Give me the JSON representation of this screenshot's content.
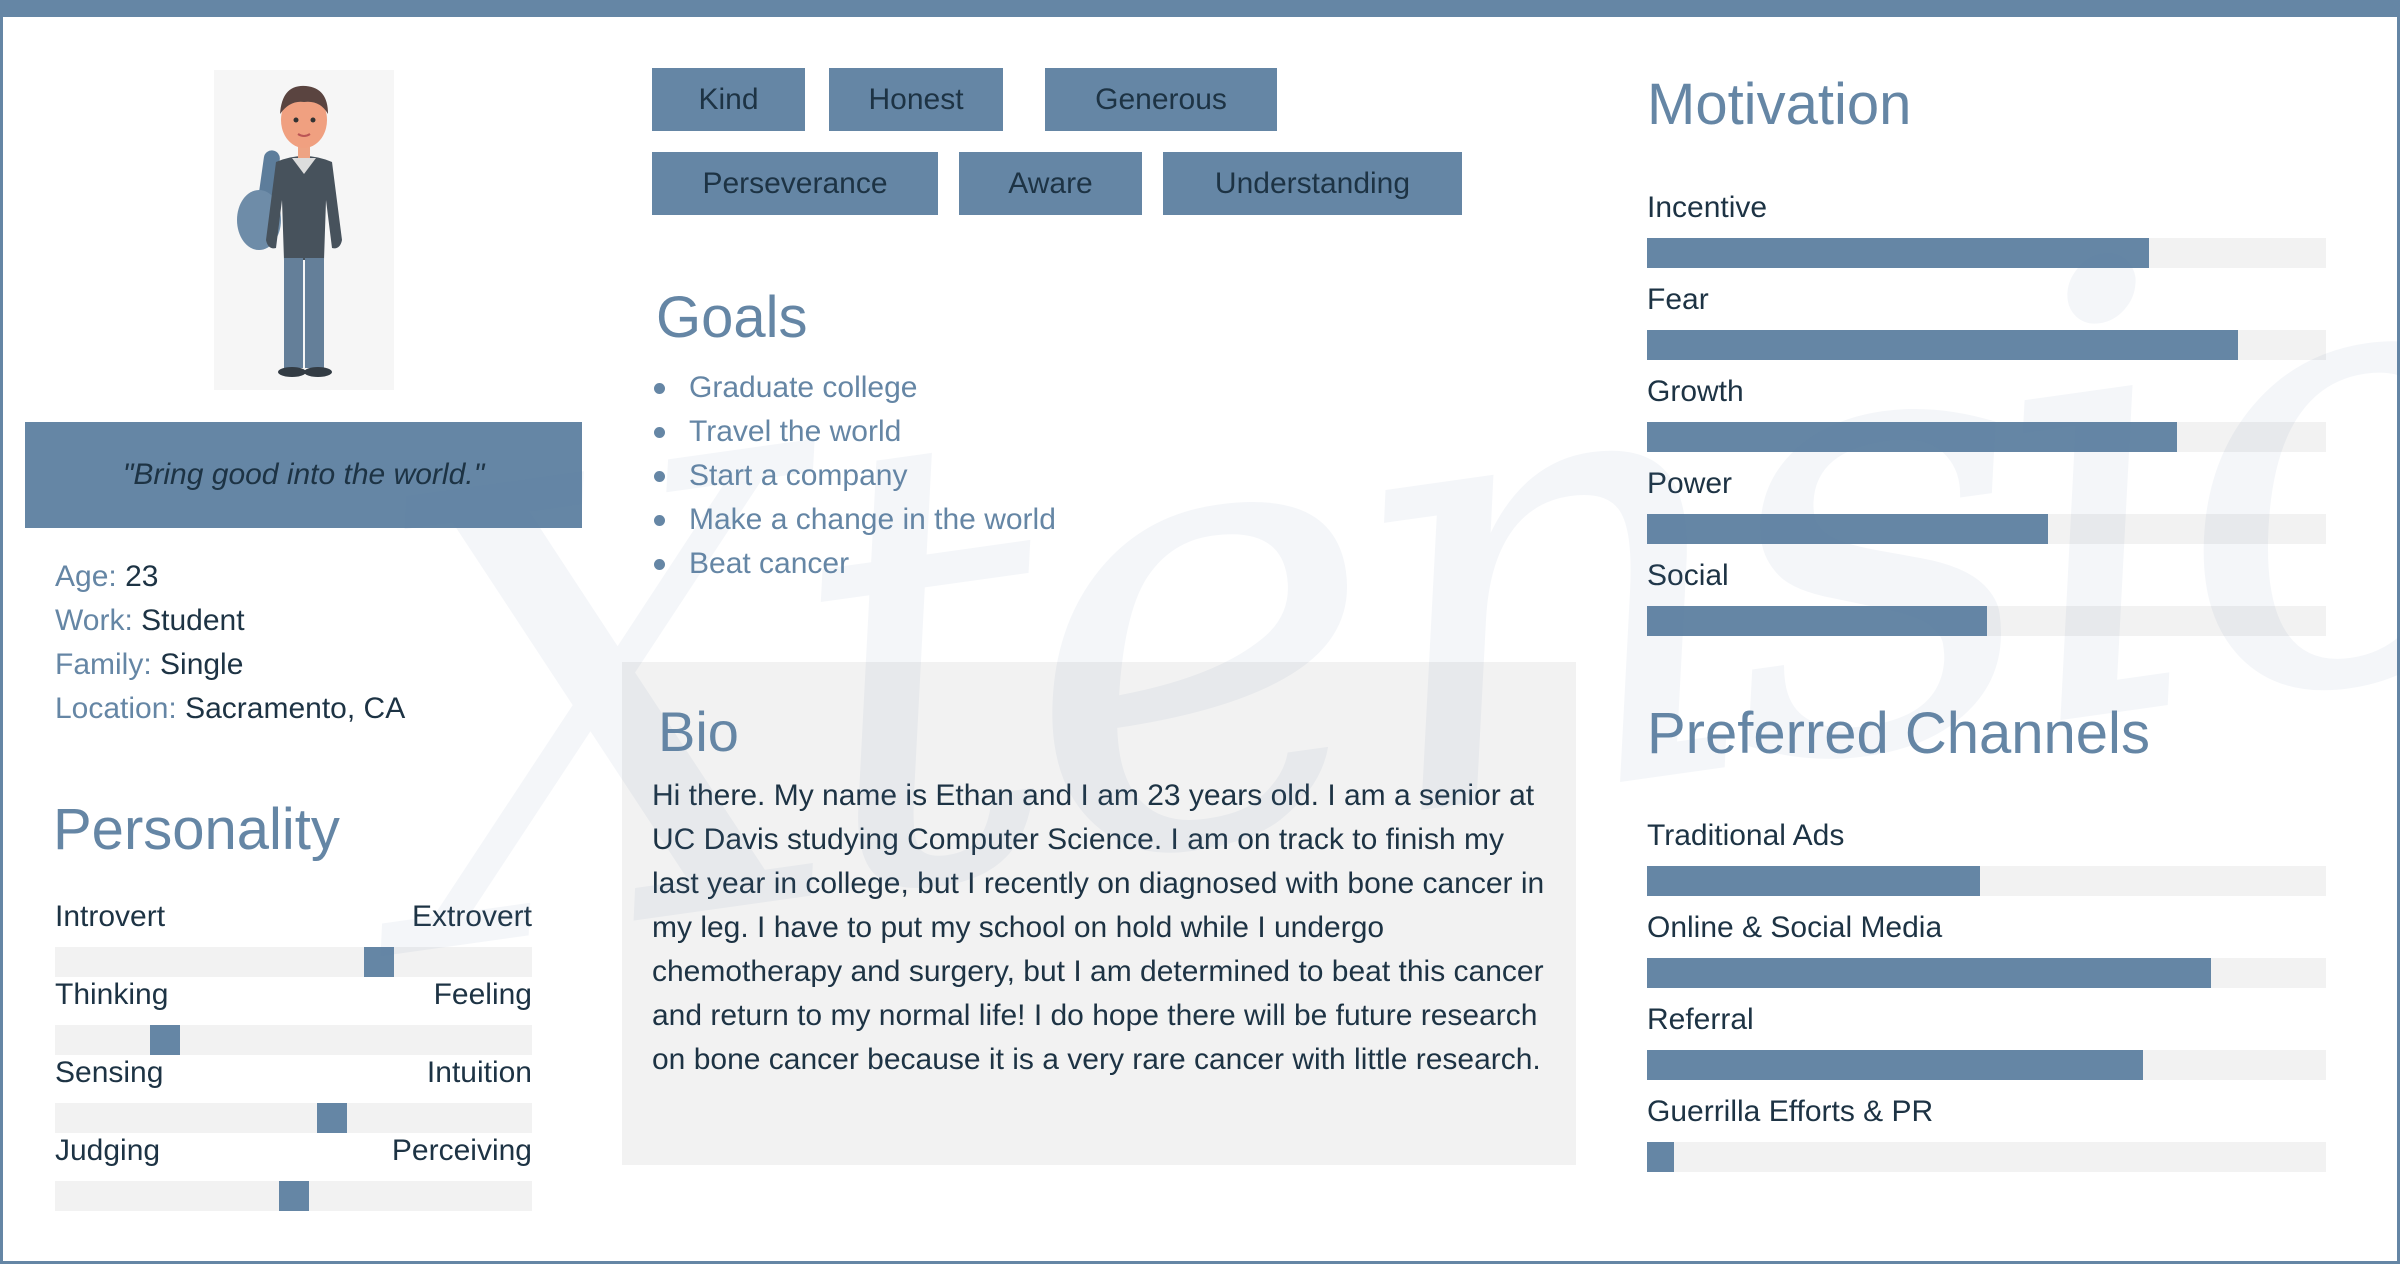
{
  "watermark": "Xtensio",
  "colors": {
    "accent": "#6586a5",
    "track": "#f2f2f2",
    "text": "#1d3344"
  },
  "profile": {
    "avatar_icon": "student-avatar",
    "quote": "\"Bring good into the world.\"",
    "info": [
      {
        "key": "Age:",
        "value": "23"
      },
      {
        "key": "Work:",
        "value": "Student"
      },
      {
        "key": "Family:",
        "value": "Single"
      },
      {
        "key": "Location:",
        "value": "Sacramento, CA"
      }
    ]
  },
  "personality": {
    "title": "Personality",
    "scales": [
      {
        "left": "Introvert",
        "right": "Extrovert",
        "value": 0.68
      },
      {
        "left": "Thinking",
        "right": "Feeling",
        "value": 0.23
      },
      {
        "left": "Sensing",
        "right": "Intuition",
        "value": 0.58
      },
      {
        "left": "Judging",
        "right": "Perceiving",
        "value": 0.5
      }
    ]
  },
  "traits": [
    "Kind",
    "Honest",
    "Generous",
    "Perseverance",
    "Aware",
    "Understanding"
  ],
  "goals": {
    "title": "Goals",
    "items": [
      "Graduate college",
      "Travel the world",
      "Start a company",
      "Make a change in the world",
      "Beat cancer"
    ]
  },
  "bio": {
    "title": "Bio",
    "text": "Hi there. My name is Ethan and I am 23 years old. I am a senior at UC Davis studying Computer Science. I am on track to finish my last year in college, but I recently on diagnosed with bone cancer in my leg. I have to put my school on hold while I undergo chemotherapy and surgery, but I am determined to beat this cancer and return to my normal life! I do hope there will be future research on bone cancer because it is a very rare cancer with little research."
  },
  "motivation": {
    "title": "Motivation",
    "items": [
      {
        "label": "Incentive",
        "value": 0.74
      },
      {
        "label": "Fear",
        "value": 0.87
      },
      {
        "label": "Growth",
        "value": 0.78
      },
      {
        "label": "Power",
        "value": 0.59
      },
      {
        "label": "Social",
        "value": 0.5
      }
    ]
  },
  "channels": {
    "title": "Preferred Channels",
    "items": [
      {
        "label": "Traditional Ads",
        "value": 0.49
      },
      {
        "label": "Online & Social Media",
        "value": 0.83
      },
      {
        "label": "Referral",
        "value": 0.73
      },
      {
        "label": "Guerrilla Efforts & PR",
        "value": 0.04
      }
    ]
  }
}
